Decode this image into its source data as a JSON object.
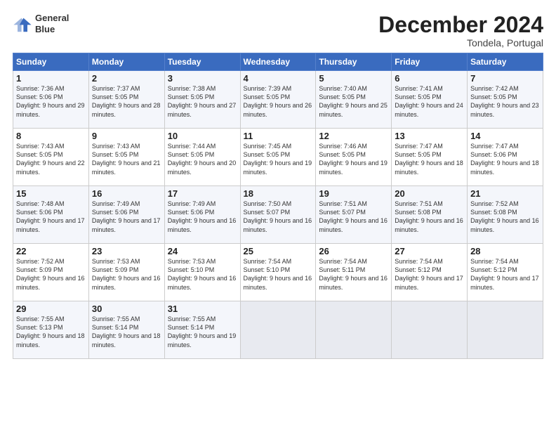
{
  "logo": {
    "line1": "General",
    "line2": "Blue"
  },
  "title": "December 2024",
  "location": "Tondela, Portugal",
  "days_of_week": [
    "Sunday",
    "Monday",
    "Tuesday",
    "Wednesday",
    "Thursday",
    "Friday",
    "Saturday"
  ],
  "weeks": [
    [
      {
        "day": 1,
        "sunrise": "7:36 AM",
        "sunset": "5:06 PM",
        "daylight": "9 hours and 29 minutes."
      },
      {
        "day": 2,
        "sunrise": "7:37 AM",
        "sunset": "5:05 PM",
        "daylight": "9 hours and 28 minutes."
      },
      {
        "day": 3,
        "sunrise": "7:38 AM",
        "sunset": "5:05 PM",
        "daylight": "9 hours and 27 minutes."
      },
      {
        "day": 4,
        "sunrise": "7:39 AM",
        "sunset": "5:05 PM",
        "daylight": "9 hours and 26 minutes."
      },
      {
        "day": 5,
        "sunrise": "7:40 AM",
        "sunset": "5:05 PM",
        "daylight": "9 hours and 25 minutes."
      },
      {
        "day": 6,
        "sunrise": "7:41 AM",
        "sunset": "5:05 PM",
        "daylight": "9 hours and 24 minutes."
      },
      {
        "day": 7,
        "sunrise": "7:42 AM",
        "sunset": "5:05 PM",
        "daylight": "9 hours and 23 minutes."
      }
    ],
    [
      {
        "day": 8,
        "sunrise": "7:43 AM",
        "sunset": "5:05 PM",
        "daylight": "9 hours and 22 minutes."
      },
      {
        "day": 9,
        "sunrise": "7:43 AM",
        "sunset": "5:05 PM",
        "daylight": "9 hours and 21 minutes."
      },
      {
        "day": 10,
        "sunrise": "7:44 AM",
        "sunset": "5:05 PM",
        "daylight": "9 hours and 20 minutes."
      },
      {
        "day": 11,
        "sunrise": "7:45 AM",
        "sunset": "5:05 PM",
        "daylight": "9 hours and 19 minutes."
      },
      {
        "day": 12,
        "sunrise": "7:46 AM",
        "sunset": "5:05 PM",
        "daylight": "9 hours and 19 minutes."
      },
      {
        "day": 13,
        "sunrise": "7:47 AM",
        "sunset": "5:05 PM",
        "daylight": "9 hours and 18 minutes."
      },
      {
        "day": 14,
        "sunrise": "7:47 AM",
        "sunset": "5:06 PM",
        "daylight": "9 hours and 18 minutes."
      }
    ],
    [
      {
        "day": 15,
        "sunrise": "7:48 AM",
        "sunset": "5:06 PM",
        "daylight": "9 hours and 17 minutes."
      },
      {
        "day": 16,
        "sunrise": "7:49 AM",
        "sunset": "5:06 PM",
        "daylight": "9 hours and 17 minutes."
      },
      {
        "day": 17,
        "sunrise": "7:49 AM",
        "sunset": "5:06 PM",
        "daylight": "9 hours and 16 minutes."
      },
      {
        "day": 18,
        "sunrise": "7:50 AM",
        "sunset": "5:07 PM",
        "daylight": "9 hours and 16 minutes."
      },
      {
        "day": 19,
        "sunrise": "7:51 AM",
        "sunset": "5:07 PM",
        "daylight": "9 hours and 16 minutes."
      },
      {
        "day": 20,
        "sunrise": "7:51 AM",
        "sunset": "5:08 PM",
        "daylight": "9 hours and 16 minutes."
      },
      {
        "day": 21,
        "sunrise": "7:52 AM",
        "sunset": "5:08 PM",
        "daylight": "9 hours and 16 minutes."
      }
    ],
    [
      {
        "day": 22,
        "sunrise": "7:52 AM",
        "sunset": "5:09 PM",
        "daylight": "9 hours and 16 minutes."
      },
      {
        "day": 23,
        "sunrise": "7:53 AM",
        "sunset": "5:09 PM",
        "daylight": "9 hours and 16 minutes."
      },
      {
        "day": 24,
        "sunrise": "7:53 AM",
        "sunset": "5:10 PM",
        "daylight": "9 hours and 16 minutes."
      },
      {
        "day": 25,
        "sunrise": "7:54 AM",
        "sunset": "5:10 PM",
        "daylight": "9 hours and 16 minutes."
      },
      {
        "day": 26,
        "sunrise": "7:54 AM",
        "sunset": "5:11 PM",
        "daylight": "9 hours and 16 minutes."
      },
      {
        "day": 27,
        "sunrise": "7:54 AM",
        "sunset": "5:12 PM",
        "daylight": "9 hours and 17 minutes."
      },
      {
        "day": 28,
        "sunrise": "7:54 AM",
        "sunset": "5:12 PM",
        "daylight": "9 hours and 17 minutes."
      }
    ],
    [
      {
        "day": 29,
        "sunrise": "7:55 AM",
        "sunset": "5:13 PM",
        "daylight": "9 hours and 18 minutes."
      },
      {
        "day": 30,
        "sunrise": "7:55 AM",
        "sunset": "5:14 PM",
        "daylight": "9 hours and 18 minutes."
      },
      {
        "day": 31,
        "sunrise": "7:55 AM",
        "sunset": "5:14 PM",
        "daylight": "9 hours and 19 minutes."
      },
      null,
      null,
      null,
      null
    ]
  ]
}
